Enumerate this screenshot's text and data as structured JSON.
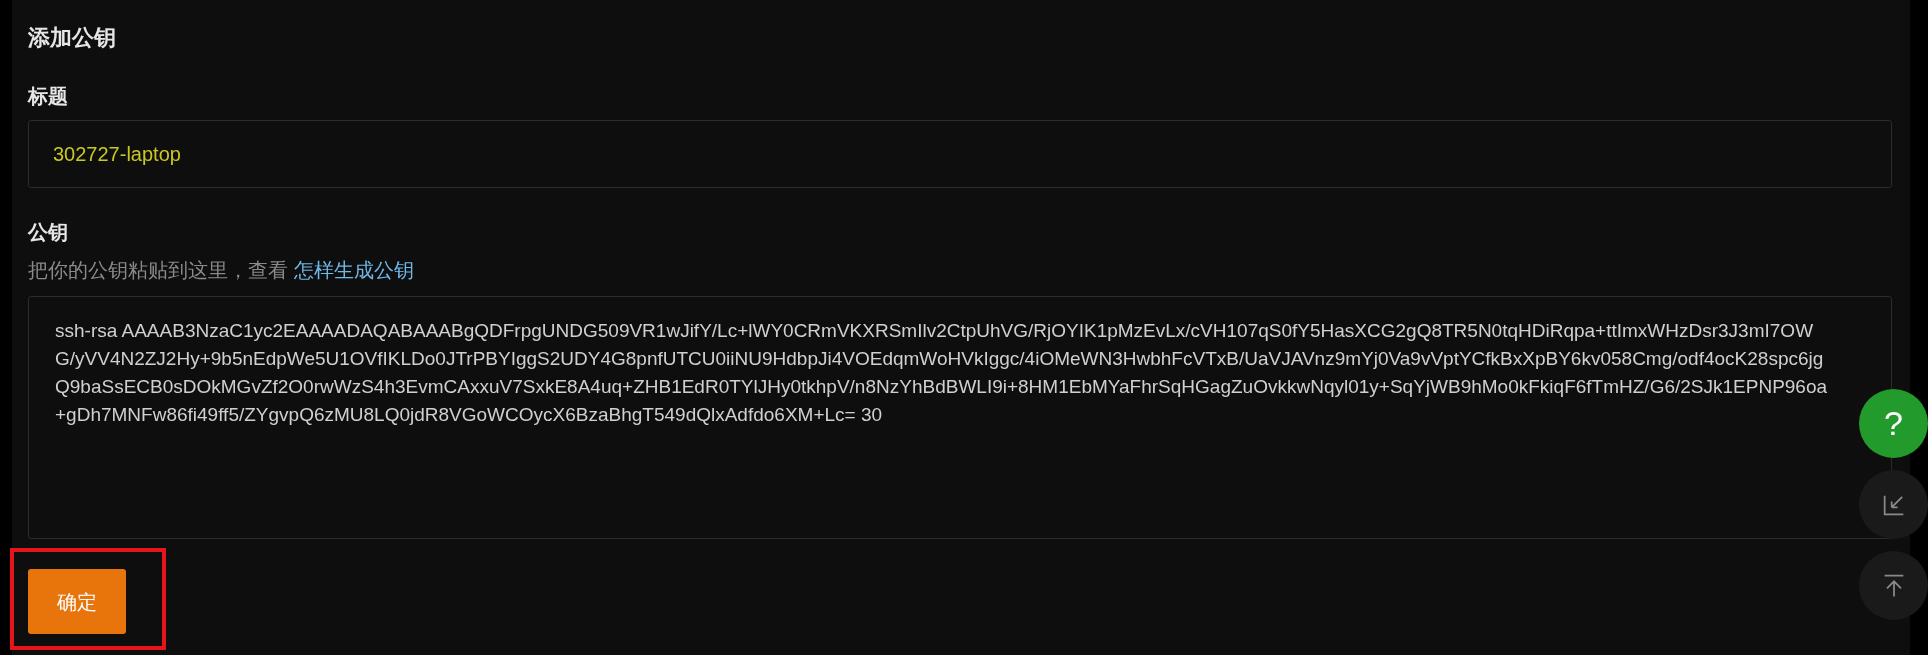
{
  "heading": "添加公钥",
  "title_field": {
    "label": "标题",
    "value": "302727-laptop"
  },
  "key_field": {
    "label": "公钥",
    "hint": "把你的公钥粘贴到这里，查看 ",
    "hint_link": "怎样生成公钥",
    "value": "ssh-rsa AAAAB3NzaC1yc2EAAAADAQABAAABgQDFrpgUNDG509VR1wJifY/Lc+lWY0CRmVKXRSmIlv2CtpUhVG/RjOYIK1pMzEvLx/cVH107qS0fY5HasXCG2gQ8TR5N0tqHDiRqpa+ttImxWHzDsr3J3mI7OWG/yVV4N2ZJ2Hy+9b5nEdpWe5U1OVfIKLDo0JTrPBYIggS2UDY4G8pnfUTCU0iiNU9HdbpJi4VOEdqmWoHVkIggc/4iOMeWN3HwbhFcVTxB/UaVJAVnz9mYj0Va9vVptYCfkBxXpBY6kv058Cmg/odf4ocK28spc6jgQ9baSsECB0sDOkMGvZf2O0rwWzS4h3EvmCAxxuV7SxkE8A4uq+ZHB1EdR0TYlJHy0tkhpV/n8NzYhBdBWLI9i+8HM1EbMYaFhrSqHGagZuOvkkwNqyl01y+SqYjWB9hMo0kFkiqF6fTmHZ/G6/2SJk1EPNP96oa+gDh7MNFw86fi49ff5/ZYgvpQ6zMU8LQ0jdR8VGoWCOycX6BzaBhgT549dQlxAdfdo6XM+Lc= 30"
  },
  "submit": "确定",
  "help_button": "?"
}
